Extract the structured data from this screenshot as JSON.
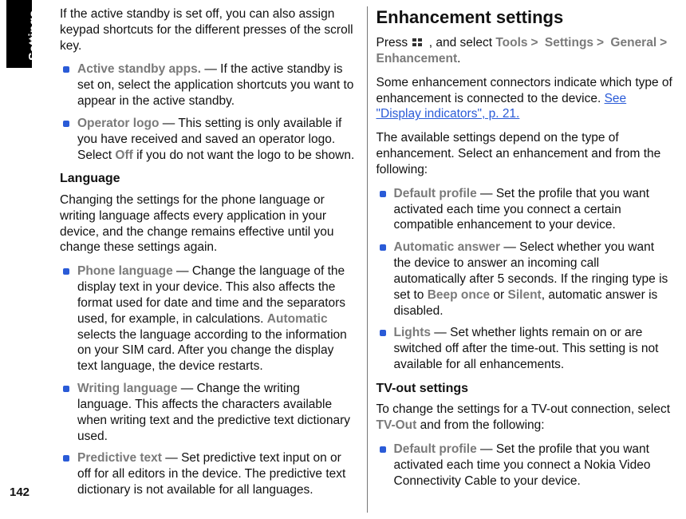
{
  "side_label": "Settings",
  "page_number": "142",
  "col1": {
    "intro_scrollkey": "If the active standby is set off, you can also assign keypad shortcuts for the different presses of the scroll key.",
    "active_standby_apps": {
      "term": "Active standby apps.",
      "text": " — If the active standby is set on, select the application shortcuts you want to appear in the active standby."
    },
    "operator_logo": {
      "term": "Operator logo",
      "text1": " — This setting is only available if you have received and saved an operator logo. Select ",
      "off": "Off",
      "text2": " if you do not want the logo to be shown."
    },
    "language_heading": "Language",
    "language_intro": "Changing the settings for the phone language or writing language affects every application in your device, and the change remains effective until you change these settings again.",
    "phone_language": {
      "term": "Phone language",
      "text1": " — Change the language of the display text in your device. This also affects the format used for date and time and the separators used, for example, in calculations. ",
      "automatic": "Automatic",
      "text2": " selects the language according to the information on your SIM card. After you change the display text language, the device restarts."
    },
    "writing_language": {
      "term": "Writing language",
      "text": " — Change the writing language. This affects the characters available when writing text and the predictive text dictionary used."
    },
    "predictive_text": {
      "term": "Predictive text",
      "text": " — Set predictive text input on or off for all editors in the device. The predictive text dictionary is not available for all languages."
    }
  },
  "col2": {
    "heading": "Enhancement settings",
    "press": "Press ",
    "and_select": ", and select ",
    "breadcrumb": {
      "a": "Tools",
      "b": "Settings",
      "c": "General",
      "d": "Enhancement"
    },
    "period": ".",
    "connectors1": "Some enhancement connectors indicate which type of enhancement is connected to the device. ",
    "see_link": "See \"Display indicators\", p. 21.",
    "available": "The available settings depend on the type of enhancement. Select an enhancement and from the following:",
    "default_profile": {
      "term": "Default profile",
      "text": " — Set the profile that you want activated each time you connect a certain compatible enhancement to your device."
    },
    "automatic_answer": {
      "term": "Automatic answer",
      "text1": " — Select whether you want the device to answer an incoming call automatically after 5 seconds. If the ringing type is set to ",
      "beep": "Beep once",
      "or": " or ",
      "silent": "Silent",
      "text2": ", automatic answer is disabled."
    },
    "lights": {
      "term": "Lights",
      "text": " — Set whether lights remain on or are switched off after the time-out. This setting is not available for all enhancements."
    },
    "tvout_heading": "TV-out settings",
    "tvout_intro1": "To change the settings for a TV-out connection, select ",
    "tvout_term": "TV-Out",
    "tvout_intro2": " and from the following:",
    "tvout_default": {
      "term": "Default profile",
      "text": " — Set the profile that you want activated each time you connect a Nokia Video Connectivity Cable to your device."
    }
  }
}
